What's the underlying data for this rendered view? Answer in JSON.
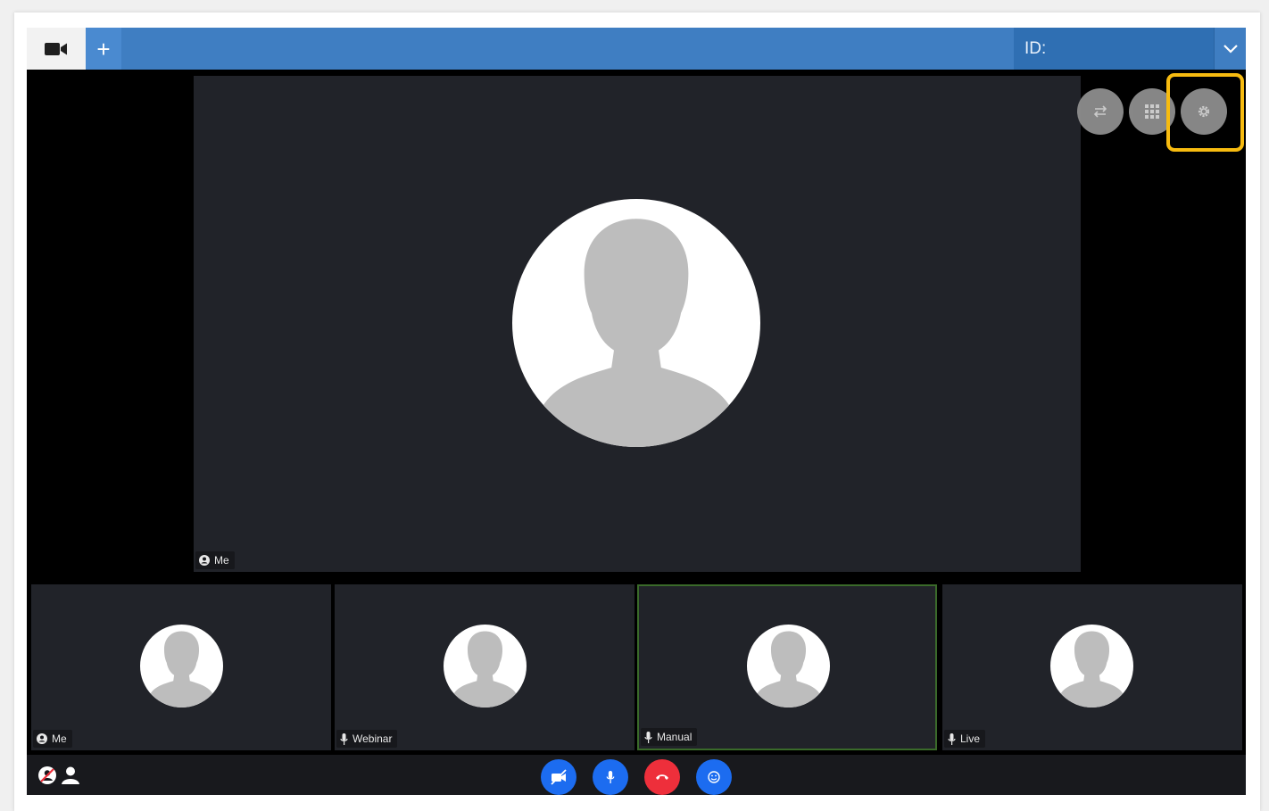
{
  "topbar": {
    "add_label": "+",
    "id_label": "ID:"
  },
  "main_video": {
    "name": "Me"
  },
  "thumbnails": [
    {
      "name": "Me",
      "status_icon": "user-circle-icon"
    },
    {
      "name": "Webinar",
      "status_icon": "microphone-icon"
    },
    {
      "name": "Manual",
      "status_icon": "microphone-icon"
    },
    {
      "name": "Live",
      "status_icon": "microphone-icon"
    }
  ],
  "colors": {
    "topbar": "#3f7ec2",
    "highlight": "#f7bb10",
    "control_blue": "#1c6cf0",
    "end_call_red": "#ee2f3b"
  }
}
